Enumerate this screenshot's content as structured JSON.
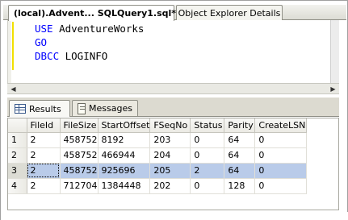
{
  "tabs": [
    {
      "label": "(local).Advent... SQLQuery1.sql*",
      "active": true
    },
    {
      "label": "Object Explorer Details",
      "active": false
    }
  ],
  "editor": {
    "lines": [
      {
        "keyword": "USE",
        "rest": " AdventureWorks"
      },
      {
        "keyword": "GO",
        "rest": ""
      },
      {
        "keyword": "DBCC",
        "rest": " LOGINFO"
      }
    ]
  },
  "result_tabs": [
    {
      "label": "Results",
      "icon": "grid-icon",
      "active": true
    },
    {
      "label": "Messages",
      "icon": "messages-icon",
      "active": false
    }
  ],
  "grid": {
    "columns": [
      "FileId",
      "FileSize",
      "StartOffset",
      "FSeqNo",
      "Status",
      "Parity",
      "CreateLSN"
    ],
    "rows": [
      {
        "num": "1",
        "cells": [
          "2",
          "458752",
          "8192",
          "203",
          "0",
          "64",
          "0"
        ]
      },
      {
        "num": "2",
        "cells": [
          "2",
          "458752",
          "466944",
          "204",
          "0",
          "64",
          "0"
        ]
      },
      {
        "num": "3",
        "cells": [
          "2",
          "458752",
          "925696",
          "205",
          "2",
          "64",
          "0"
        ],
        "selected": true
      },
      {
        "num": "4",
        "cells": [
          "2",
          "712704",
          "1384448",
          "202",
          "0",
          "128",
          "0"
        ]
      }
    ]
  },
  "colors": {
    "keyword": "#0000ff",
    "selection": "#b9cbe9"
  }
}
